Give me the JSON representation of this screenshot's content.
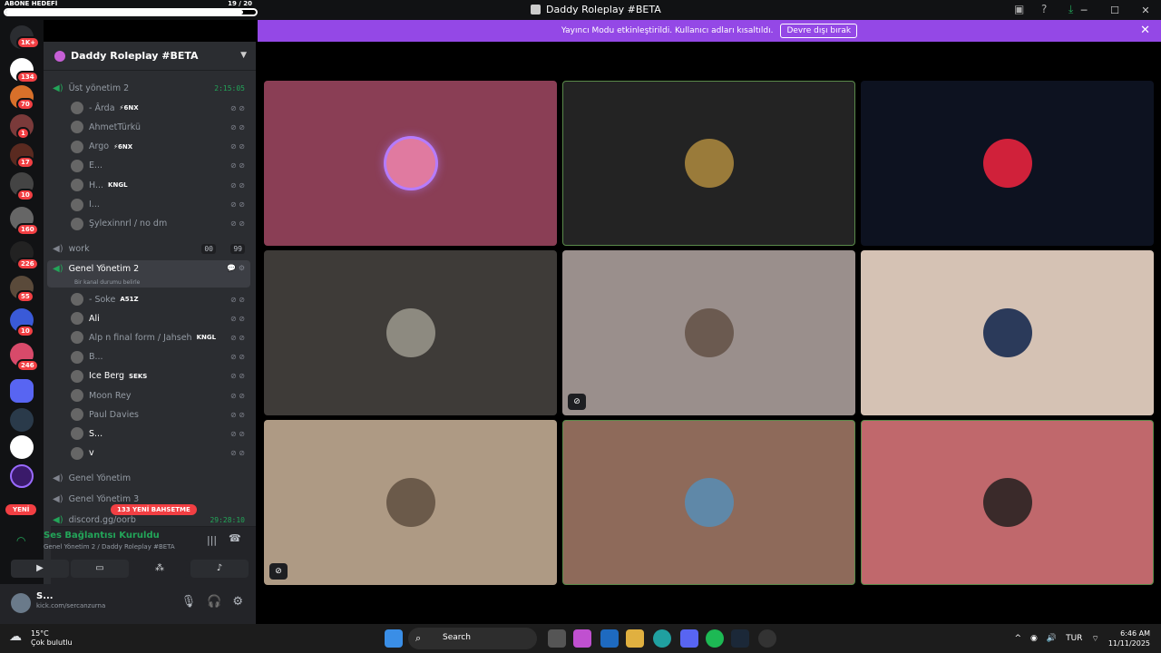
{
  "goal": {
    "label": "ABONE HEDEFİ",
    "count": "19 / 20",
    "progress": 0.95
  },
  "window": {
    "title": "Daddy Roleplay #BETA"
  },
  "banner": {
    "text": "Yayıncı Modu etkinleştirildi. Kullanıcı adları kısaltıldı.",
    "button": "Devre dışı bırak"
  },
  "servers": {
    "badges": [
      "1K+",
      "134",
      "70",
      "1",
      "17",
      "10",
      "160",
      "226",
      "55",
      "10",
      "246"
    ],
    "new_label": "YENİ"
  },
  "guild": {
    "name": "Daddy Roleplay #BETA"
  },
  "channels": {
    "ust": {
      "name": "Üst yönetim 2",
      "time": "2:15:05"
    },
    "ust_users": [
      {
        "name": "- Ârda",
        "tag": "⚡6NX"
      },
      {
        "name": "AhmetTürkü",
        "tag": ""
      },
      {
        "name": "Argo",
        "tag": "⚡6NX"
      },
      {
        "name": "E...",
        "tag": ""
      },
      {
        "name": "H...",
        "tag": "KNGL"
      },
      {
        "name": "I...",
        "tag": ""
      },
      {
        "name": "Şylexinnrl / no dm",
        "tag": ""
      }
    ],
    "work": {
      "name": "work",
      "count_a": "00",
      "count_b": "99"
    },
    "genel2": {
      "name": "Genel Yönetim 2",
      "status": "Bir kanal durumu belirle"
    },
    "genel2_users": [
      {
        "name": "- Soke",
        "tag": "A51Z"
      },
      {
        "name": "Ali",
        "tag": ""
      },
      {
        "name": "Alp n final form / Jahseh",
        "tag": "KNGL"
      },
      {
        "name": "B...",
        "tag": ""
      },
      {
        "name": "Ice Berg",
        "tag": "SEKS"
      },
      {
        "name": "Moon Rey",
        "tag": ""
      },
      {
        "name": "Paul Davies",
        "tag": ""
      },
      {
        "name": "S...",
        "tag": ""
      },
      {
        "name": "v",
        "tag": ""
      }
    ],
    "genel": {
      "name": "Genel Yönetim"
    },
    "genel3": {
      "name": "Genel Yönetim 3"
    },
    "discord": {
      "name": "discord.gg/oorb",
      "time": "29:28:10"
    },
    "mention": "133 YENİ BAHSETME"
  },
  "voice": {
    "title": "Ses Bağlantısı Kuruldu",
    "sub": "Genel Yönetim 2 / Daddy Roleplay #BETA"
  },
  "user": {
    "name": "S...",
    "sub": "kick.com/sercanzurna"
  },
  "tiles": [
    {
      "bg": "#8a3e55",
      "avatar": "#e07aa0",
      "ring": "#b57cff",
      "border": "none",
      "mute": false
    },
    {
      "bg": "#232323",
      "avatar": "#9a7b3a",
      "ring": "none",
      "border": "#5a8a4a",
      "mute": false
    },
    {
      "bg": "#0d1220",
      "avatar": "#d0213a",
      "ring": "none",
      "border": "none",
      "mute": false
    },
    {
      "bg": "#3e3b38",
      "avatar": "#8d8a80",
      "ring": "none",
      "border": "none",
      "mute": false
    },
    {
      "bg": "#9a8f8c",
      "avatar": "#6b5a50",
      "ring": "none",
      "border": "none",
      "mute": true
    },
    {
      "bg": "#d5c2b4",
      "avatar": "#2b3a5a",
      "ring": "none",
      "border": "none",
      "mute": false
    },
    {
      "bg": "#ae9a84",
      "avatar": "#6b5a4a",
      "ring": "none",
      "border": "none",
      "mute": true
    },
    {
      "bg": "#8e6a5a",
      "avatar": "#5f88a8",
      "ring": "none",
      "border": "#5a8a4a",
      "mute": false
    },
    {
      "bg": "#c0686c",
      "avatar": "#3a2a2a",
      "ring": "none",
      "border": "#5a8a4a",
      "mute": false
    }
  ],
  "taskbar": {
    "temp": "15°C",
    "weather": "Çok bulutlu",
    "search": "Search",
    "lang": "TUR",
    "time": "6:46 AM",
    "date": "11/11/2025"
  }
}
